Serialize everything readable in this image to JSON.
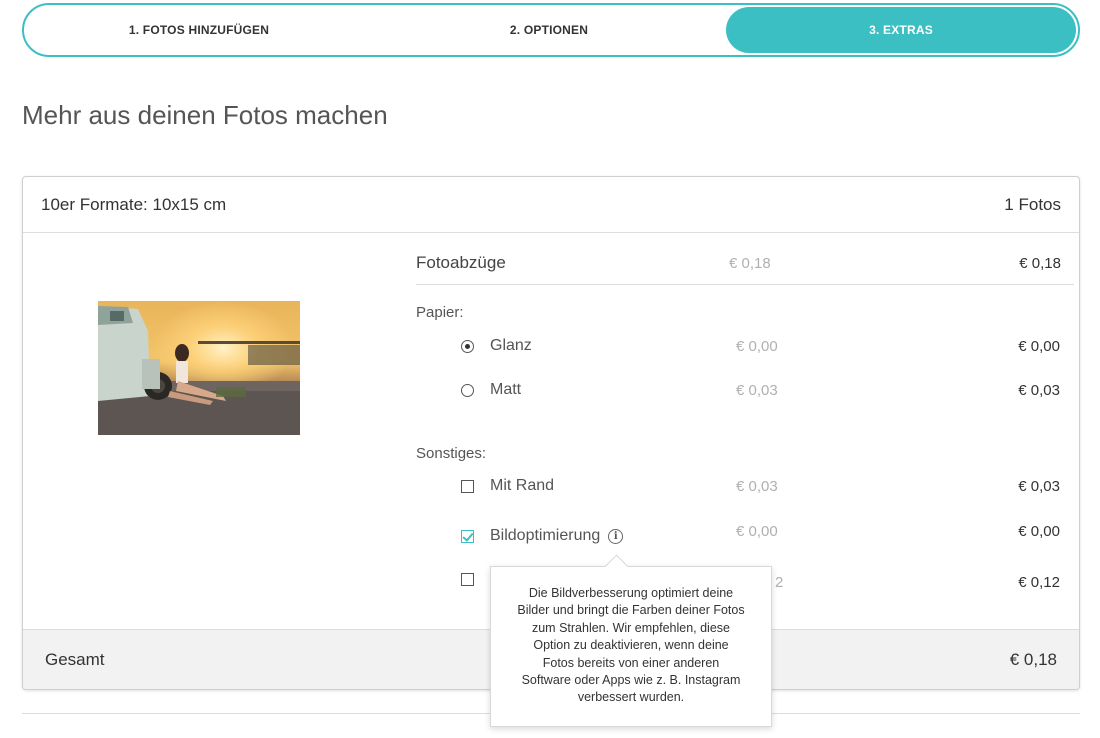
{
  "stepper": {
    "steps": [
      {
        "label": "1. FOTOS HINZUFÜGEN"
      },
      {
        "label": "2. OPTIONEN"
      },
      {
        "label": "3. EXTRAS"
      }
    ],
    "active_step": 3,
    "accent_color": "#3bbfc3"
  },
  "page": {
    "title": "Mehr aus deinen Fotos machen"
  },
  "card": {
    "format_label": "10er Formate: 10x15 cm",
    "count_label": "1 Fotos",
    "photo": {
      "alt": "photo-thumbnail"
    },
    "prints": {
      "label": "Fotoabzüge",
      "unit_price": "€ 0,18",
      "total": "€ 0,18"
    },
    "paper": {
      "section_label": "Papier:",
      "options": [
        {
          "label": "Glanz",
          "selected": true,
          "unit_price": "€ 0,00",
          "total": "€ 0,00"
        },
        {
          "label": "Matt",
          "selected": false,
          "unit_price": "€ 0,03",
          "total": "€ 0,03"
        }
      ]
    },
    "other": {
      "section_label": "Sonstiges:",
      "options": [
        {
          "label": "Mit Rand",
          "checked": false,
          "unit_price": "€ 0,03",
          "total": "€ 0,03"
        },
        {
          "label": "Bildoptimierung",
          "checked": true,
          "unit_price": "€ 0,00",
          "total": "€ 0,00"
        },
        {
          "label": "",
          "checked": false,
          "unit_price": "2",
          "total": "€ 0,12"
        }
      ]
    },
    "footer": {
      "label": "Gesamt",
      "value": "€ 0,18"
    }
  },
  "tooltip": {
    "lines": [
      "Die Bildverbesserung optimiert deine",
      "Bilder und bringt die Farben deiner Fotos",
      "zum Strahlen. Wir empfehlen, diese",
      "Option zu deaktivieren, wenn deine",
      "Fotos bereits von einer anderen",
      "Software oder Apps wie z. B. Instagram",
      "verbessert wurden."
    ]
  }
}
